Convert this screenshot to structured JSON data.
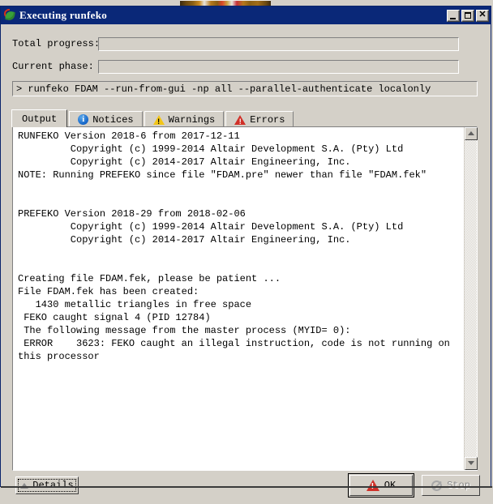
{
  "window": {
    "title": "Executing runfeko",
    "icon": "feko-leaf-icon",
    "controls": {
      "minimize": "minimize-button",
      "maximize": "maximize-button",
      "close": "✕"
    }
  },
  "progress": {
    "total": {
      "label": "Total progress:",
      "value_percent": 0
    },
    "phase": {
      "label": "Current phase:",
      "value_percent": 0
    }
  },
  "command": {
    "text": "> runfeko FDAM --run-from-gui -np all --parallel-authenticate localonly"
  },
  "tabs": [
    {
      "id": "output",
      "label": "Output",
      "icon": "none",
      "selected": true
    },
    {
      "id": "notices",
      "label": "Notices",
      "icon": "info-icon",
      "selected": false
    },
    {
      "id": "warnings",
      "label": "Warnings",
      "icon": "warning-icon",
      "selected": false
    },
    {
      "id": "errors",
      "label": "Errors",
      "icon": "error-icon",
      "selected": false
    }
  ],
  "output": {
    "text": "RUNFEKO Version 2018-6 from 2017-12-11\n         Copyright (c) 1999-2014 Altair Development S.A. (Pty) Ltd\n         Copyright (c) 2014-2017 Altair Engineering, Inc.\nNOTE: Running PREFEKO since file \"FDAM.pre\" newer than file \"FDAM.fek\"\n\n\nPREFEKO Version 2018-29 from 2018-02-06\n         Copyright (c) 1999-2014 Altair Development S.A. (Pty) Ltd\n         Copyright (c) 2014-2017 Altair Engineering, Inc.\n\n\nCreating file FDAM.fek, please be patient ...\nFile FDAM.fek has been created:\n   1430 metallic triangles in free space\n FEKO caught signal 4 (PID 12784)\n The following message from the master process (MYID= 0):\n ERROR    3623: FEKO caught an illegal instruction, code is not running on\nthis processor"
  },
  "scrollbar": {
    "up_arrow": "scroll-up-arrow",
    "down_arrow": "scroll-down-arrow"
  },
  "footer": {
    "details_label": "Details",
    "ok_label": "OK",
    "stop_label": "Stop"
  },
  "colors": {
    "titlebar": "#0a2878",
    "face": "#d4d0c8",
    "error_red": "#d03028",
    "warning_yellow": "#f2c518",
    "info_blue": "#1565c8",
    "text_bg": "#ffffff"
  }
}
